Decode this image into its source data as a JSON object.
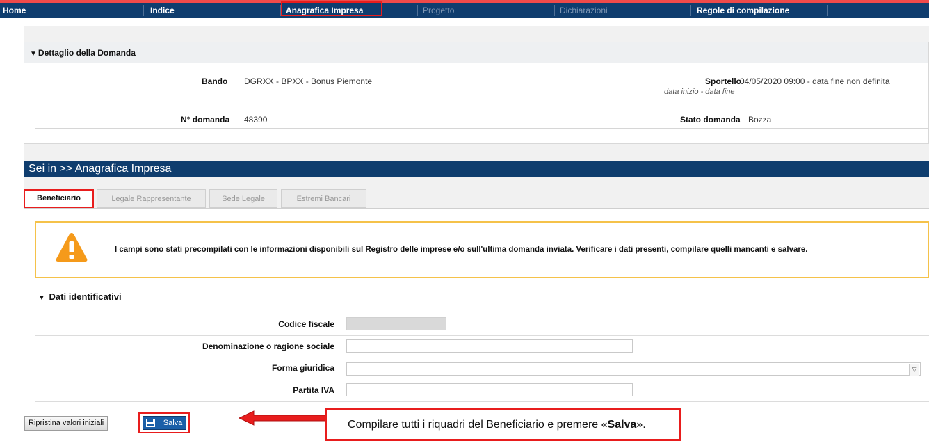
{
  "nav": {
    "items": [
      {
        "label": "Home"
      },
      {
        "label": "Indice"
      },
      {
        "label": "Anagrafica Impresa"
      },
      {
        "label": "Progetto"
      },
      {
        "label": "Dichiarazioni"
      },
      {
        "label": "Regole di compilazione"
      }
    ]
  },
  "dettaglio": {
    "title": "Dettaglio della Domanda",
    "bando_label": "Bando",
    "bando_value": "DGRXX - BPXX - Bonus Piemonte",
    "sportello_label": "Sportello",
    "sportello_sub": "data inizio - data fine",
    "sportello_value": "04/05/2020 09:00 - data fine non definita",
    "domanda_label": "N° domanda",
    "domanda_value": "48390",
    "stato_label": "Stato domanda",
    "stato_value": "Bozza"
  },
  "breadcrumb": "Sei in >> Anagrafica Impresa",
  "tabs": [
    {
      "label": "Beneficiario"
    },
    {
      "label": "Legale Rappresentante"
    },
    {
      "label": "Sede Legale"
    },
    {
      "label": "Estremi Bancari"
    }
  ],
  "warning": "I campi sono stati precompilati con le informazioni disponibili sul Registro delle imprese e/o sull'ultima domanda inviata. Verificare i dati presenti, compilare quelli mancanti e salvare.",
  "section": {
    "title": "Dati identificativi",
    "fields": [
      {
        "label": "Codice fiscale",
        "value": ""
      },
      {
        "label": "Denominazione o ragione sociale",
        "value": ""
      },
      {
        "label": "Forma giuridica",
        "value": ""
      },
      {
        "label": "Partita IVA",
        "value": ""
      }
    ]
  },
  "buttons": {
    "reset": "Ripristina valori iniziali",
    "save": "Salva"
  },
  "callout": {
    "text_before": "Compilare tutti i riquadri del Beneficiario e premere «",
    "bold": "Salva",
    "text_after": "»."
  },
  "colors": {
    "nav_bg": "#0f3d6e",
    "highlight": "#e81d1d",
    "warning_border": "#f5c24a",
    "warning_icon": "#f59a1a"
  }
}
